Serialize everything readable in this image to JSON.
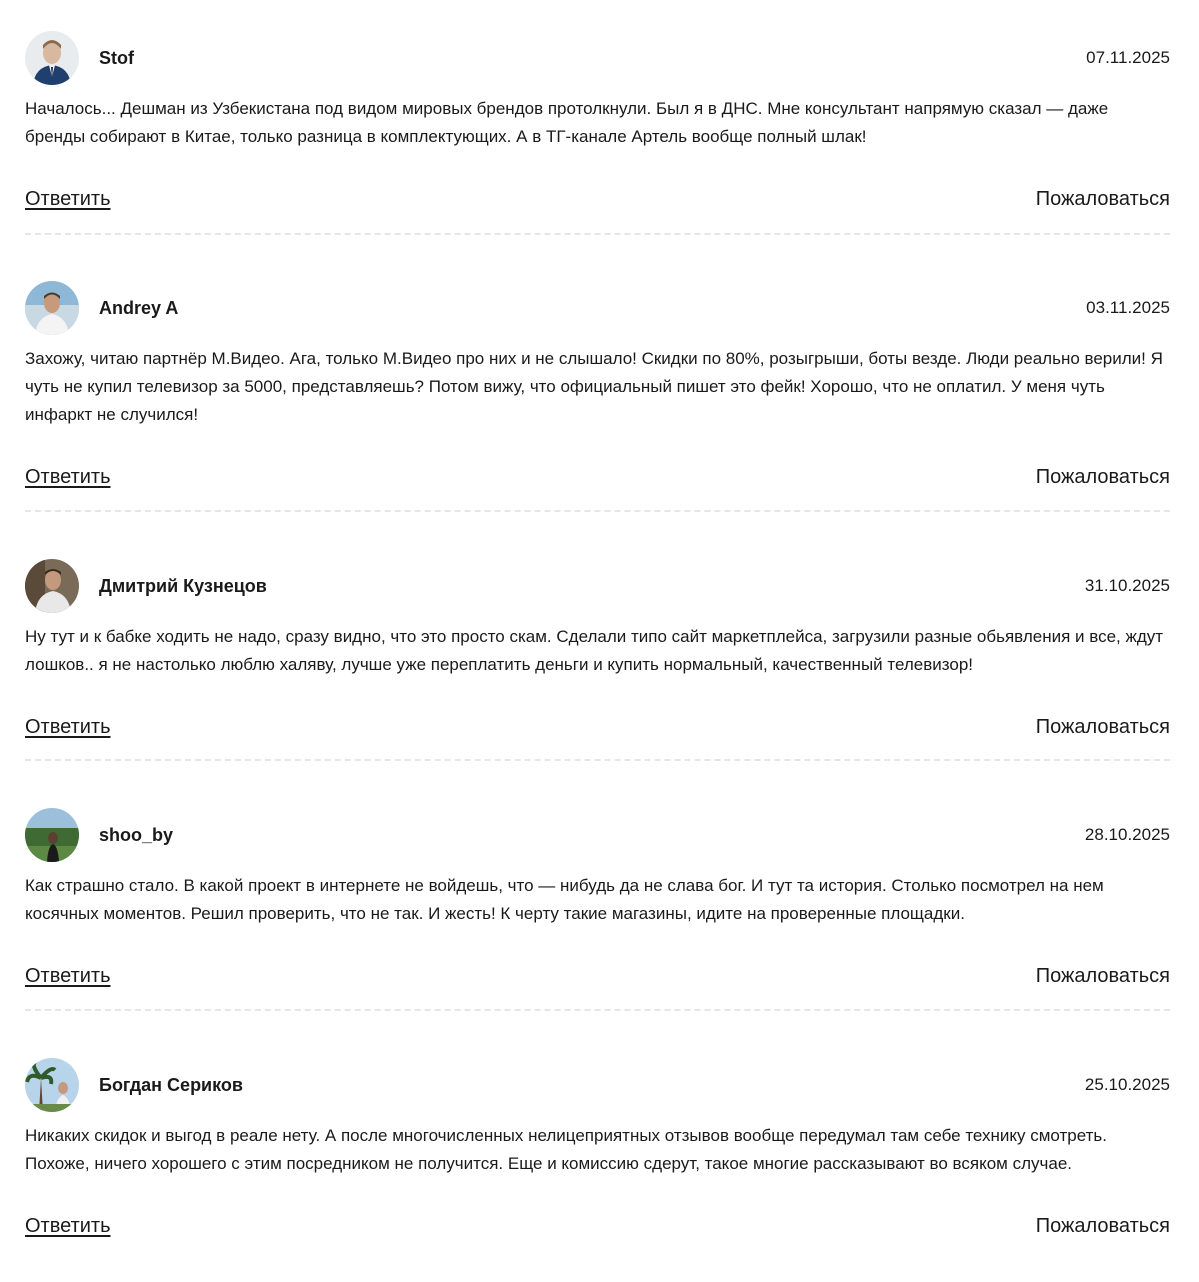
{
  "comments": [
    {
      "author": "Stof",
      "date": "07.11.2025",
      "text": "Началось... Дешман из Узбекистана под видом мировых брендов протолкнули. Был я в ДНС. Мне консультант напрямую сказал — даже бренды собирают в Китае, только разница в комплектующих. А в ТГ-канале Артель вообще полный шлак!",
      "reply_label": "Ответить",
      "report_label": "Пожаловаться"
    },
    {
      "author": "Andrey A",
      "date": "03.11.2025",
      "text": "Захожу, читаю партнёр М.Видео. Ага, только М.Видео про них и не слышало! Скидки по 80%, розыгрыши, боты везде. Люди реально верили! Я чуть не купил телевизор за 5000, представляешь? Потом вижу, что официальный пишет это фейк! Хорошо, что не оплатил. У меня чуть инфаркт не случился!",
      "reply_label": "Ответить",
      "report_label": "Пожаловаться"
    },
    {
      "author": "Дмитрий Кузнецов",
      "date": "31.10.2025",
      "text": "Ну тут и к бабке ходить не надо, сразу видно, что это просто скам. Сделали типо сайт маркетплейса, загрузили разные обьявления и все, ждут лошков.. я не настолько люблю халяву, лучше уже переплатить деньги и купить нормальный, качественный телевизор!",
      "reply_label": "Ответить",
      "report_label": "Пожаловаться"
    },
    {
      "author": "shoo_by",
      "date": "28.10.2025",
      "text": "Как страшно стало. В какой проект в интернете не войдешь, что — нибудь да не слава бог. И тут та история. Столько посмотрел на нем косячных моментов. Решил проверить, что не так. И жесть! К черту такие магазины, идите на проверенные площадки.",
      "reply_label": "Ответить",
      "report_label": "Пожаловаться"
    },
    {
      "author": "Богдан Сериков",
      "date": "25.10.2025",
      "text": "Никаких скидок и выгод в реале нету. А после многочисленных нелицеприятных отзывов вообще передумал там себе технику смотреть. Похоже, ничего хорошего с этим посредником не получится. Еще и комиссию сдерут, такое многие рассказывают во всяком случае.",
      "reply_label": "Ответить",
      "report_label": "Пожаловаться"
    }
  ]
}
